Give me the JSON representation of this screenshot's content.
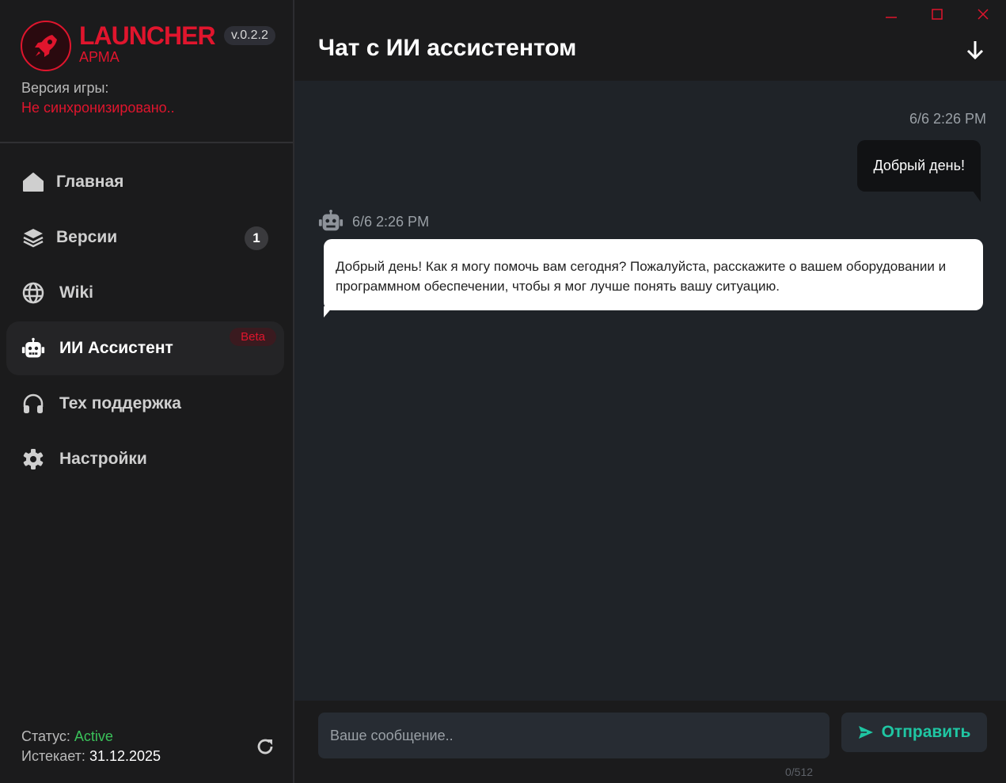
{
  "app": {
    "title": "LAUNCHER",
    "subtitle": "АРМА",
    "version": "v.0.2.2",
    "accent_color": "#e0152d"
  },
  "game_version": {
    "label": "Версия игры:",
    "status": "Не синхронизировано.."
  },
  "nav": {
    "items": [
      {
        "label": "Главная",
        "icon": "home-icon"
      },
      {
        "label": "Версии",
        "icon": "layers-icon",
        "badge": "1"
      },
      {
        "label": "Wiki",
        "icon": "globe-icon"
      },
      {
        "label": "ИИ Ассистент",
        "icon": "robot-icon",
        "badge": "Beta",
        "active": true
      },
      {
        "label": "Тех поддержка",
        "icon": "headphones-icon"
      },
      {
        "label": "Настройки",
        "icon": "gear-icon"
      }
    ]
  },
  "account": {
    "status_label": "Статус:",
    "status_value": "Active",
    "status_color": "#3ac25a",
    "expires_label": "Истекает:",
    "expires_value": "31.12.2025"
  },
  "chat": {
    "title": "Чат с ИИ ассистентом",
    "messages": [
      {
        "role": "user",
        "time": "6/6 2:26 PM",
        "text": "Добрый день!"
      },
      {
        "role": "assistant",
        "time": "6/6 2:26 PM",
        "text": "Добрый день! Как я могу помочь вам сегодня? Пожалуйста, расскажите о вашем оборудовании и программном обеспечении, чтобы я мог лучше понять вашу ситуацию."
      }
    ],
    "input_placeholder": "Ваше сообщение..",
    "input_value": "",
    "send_label": "Отправить",
    "char_count": "0/512",
    "send_color": "#1fc6a3"
  }
}
